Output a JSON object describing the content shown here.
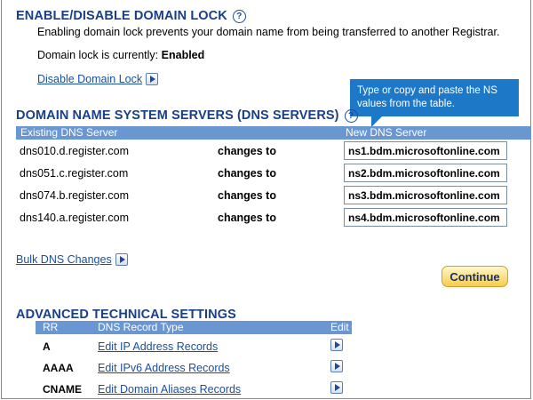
{
  "domain_lock": {
    "title": "ENABLE/DISABLE DOMAIN LOCK",
    "description": "Enabling domain lock prevents your domain name from being transferred to another Registrar.",
    "status_label": "Domain lock is currently:",
    "status_value": "Enabled",
    "disable_link": "Disable Domain Lock"
  },
  "dns": {
    "title": "DOMAIN NAME SYSTEM SERVERS (DNS SERVERS)",
    "callout": "Type or copy and paste the NS values from the table.",
    "col_existing": "Existing DNS Server",
    "col_new": "New DNS Server",
    "changes_to": "changes to",
    "rows": [
      {
        "existing": "dns010.d.register.com",
        "new": "ns1.bdm.microsoftonline.com"
      },
      {
        "existing": "dns051.c.register.com",
        "new": "ns2.bdm.microsoftonline.com"
      },
      {
        "existing": "dns074.b.register.com",
        "new": "ns3.bdm.microsoftonline.com"
      },
      {
        "existing": "dns140.a.register.com",
        "new": "ns4.bdm.microsoftonline.com"
      }
    ],
    "bulk_link": "Bulk DNS Changes",
    "continue_label": "Continue"
  },
  "advanced": {
    "title": "ADVANCED TECHNICAL SETTINGS",
    "col_rr": "RR",
    "col_type": "DNS Record Type",
    "col_edit": "Edit",
    "rows": [
      {
        "rr": "A",
        "label": "Edit IP Address Records"
      },
      {
        "rr": "AAAA",
        "label": "Edit IPv6 Address Records"
      },
      {
        "rr": "CNAME",
        "label": "Edit Domain Aliases Records"
      }
    ]
  },
  "colors": {
    "heading": "#1a3f87",
    "link": "#1a4fa0",
    "table_header": "#6a96d2",
    "callout": "#1e78c8",
    "continue_button": "#f7cc4a"
  },
  "icons": [
    "help-icon",
    "arrow-right-icon"
  ]
}
